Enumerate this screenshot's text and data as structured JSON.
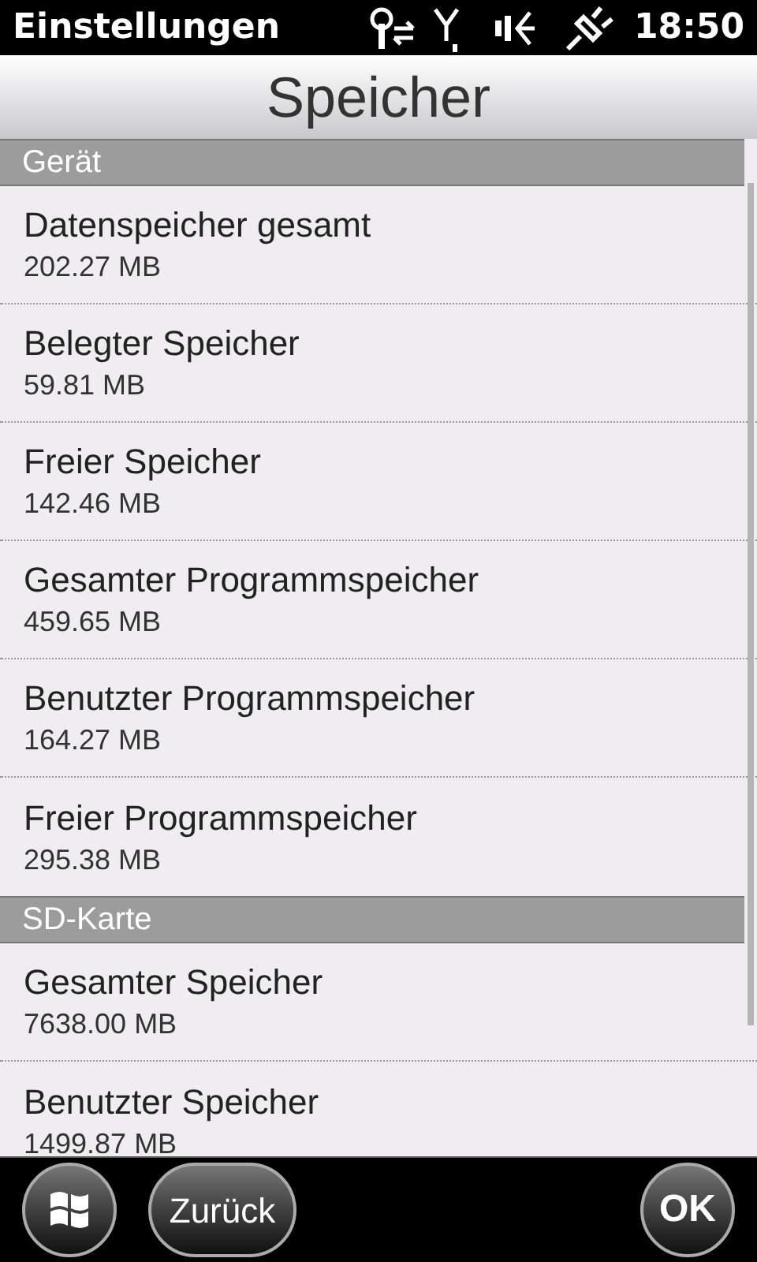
{
  "status_bar": {
    "app_title": "Einstellungen",
    "time": "18:50"
  },
  "title": "Speicher",
  "sections": [
    {
      "header": "Gerät",
      "items": [
        {
          "label": "Datenspeicher gesamt",
          "value": "202.27 MB"
        },
        {
          "label": "Belegter Speicher",
          "value": "59.81 MB"
        },
        {
          "label": "Freier Speicher",
          "value": "142.46 MB"
        },
        {
          "label": "Gesamter Programmspeicher",
          "value": "459.65 MB"
        },
        {
          "label": "Benutzter Programmspeicher",
          "value": "164.27 MB"
        },
        {
          "label": "Freier Programmspeicher",
          "value": "295.38 MB"
        }
      ]
    },
    {
      "header": "SD-Karte",
      "items": [
        {
          "label": "Gesamter Speicher",
          "value": "7638.00 MB"
        },
        {
          "label": "Benutzter Speicher",
          "value": "1499.87 MB"
        }
      ]
    }
  ],
  "buttons": {
    "back": "Zurück",
    "ok": "OK"
  }
}
